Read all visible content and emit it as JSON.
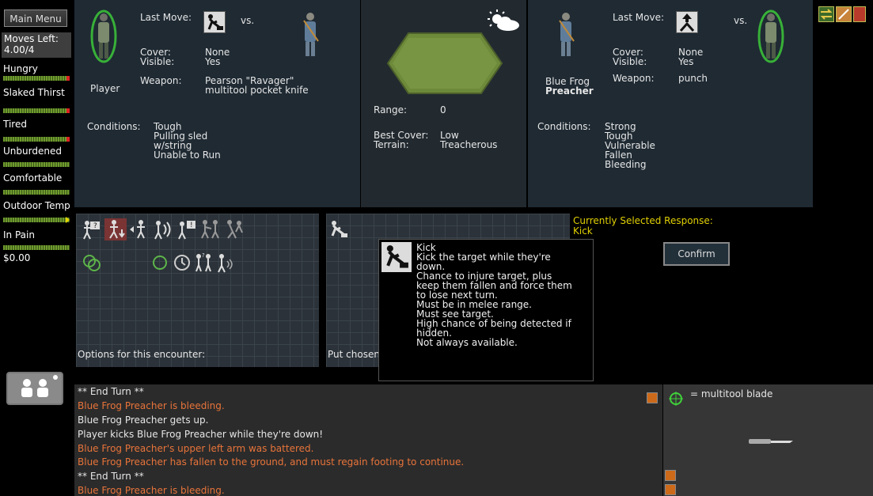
{
  "sidebar": {
    "main_menu": "Main Menu",
    "moves_left_label": "Moves Left:",
    "moves_left_value": "4.00/4",
    "statuses": [
      {
        "label": "Hungry",
        "indicator": "red"
      },
      {
        "label": "Slaked Thirst",
        "indicator": "red"
      },
      {
        "label": "Tired",
        "indicator": "red"
      },
      {
        "label": "Unburdened",
        "indicator": "none"
      },
      {
        "label": "Comfortable",
        "indicator": "none"
      },
      {
        "label": "Outdoor Temp",
        "indicator": "yellow"
      },
      {
        "label": "In Pain",
        "indicator": "none"
      }
    ],
    "money": "$0.00"
  },
  "player_panel": {
    "last_move_label": "Last Move:",
    "vs_label": "vs.",
    "name": "Player",
    "cover_label": "Cover:",
    "cover_value": "None",
    "visible_label": "Visible:",
    "visible_value": "Yes",
    "weapon_label": "Weapon:",
    "weapon_line1": "Pearson \"Ravager\"",
    "weapon_line2": "multitool pocket knife",
    "conditions_label": "Conditions:",
    "conditions": [
      "Tough",
      "Pulling sled",
      "w/string",
      "Unable to Run"
    ]
  },
  "center_panel": {
    "weather_icon": "partly-sunny-icon",
    "range_label": "Range:",
    "range_value": "0",
    "best_cover_label": "Best Cover:",
    "best_cover_value": "Low",
    "terrain_label": "Terrain:",
    "terrain_value": "Treacherous"
  },
  "enemy_panel": {
    "last_move_label": "Last Move:",
    "vs_label": "vs.",
    "name_line1": "Blue Frog",
    "name_line2": "Preacher",
    "cover_label": "Cover:",
    "cover_value": "None",
    "visible_label": "Visible:",
    "visible_value": "Yes",
    "weapon_label": "Weapon:",
    "weapon_value": "punch",
    "conditions_label": "Conditions:",
    "conditions": [
      "Strong",
      "Tough",
      "Vulnerable",
      "Fallen",
      "Bleeding"
    ]
  },
  "options_panel": {
    "caption": "Options for this encounter:"
  },
  "response_panel": {
    "caption": "Put chosen optio",
    "selected_label": "Currently Selected Response:",
    "selected_value": "Kick",
    "confirm": "Confirm"
  },
  "tooltip": {
    "title": "Kick",
    "lines": [
      "Kick the target while they're",
      "down.",
      "Chance to injure target, plus",
      "keep them fallen and force them",
      "to lose next turn.",
      "Must be in melee range.",
      "Must see target.",
      "High chance of being detected if",
      "hidden.",
      "Not always available."
    ]
  },
  "log": {
    "lines": [
      {
        "text": "** End Turn **",
        "color": "#e6e6e6"
      },
      {
        "text": "Blue Frog Preacher is bleeding.",
        "color": "#e8743a"
      },
      {
        "text": "Blue Frog Preacher gets up.",
        "color": "#e6e6e6"
      },
      {
        "text": "Player kicks Blue Frog Preacher while they're down!",
        "color": "#e6e6e6"
      },
      {
        "text": "Blue Frog Preacher's upper left arm was battered.",
        "color": "#e8743a"
      },
      {
        "text": "Blue Frog Preacher has fallen to the ground, and must regain footing to continue.",
        "color": "#e8743a"
      },
      {
        "text": "** End Turn **",
        "color": "#e6e6e6"
      },
      {
        "text": "Blue Frog Preacher is bleeding.",
        "color": "#e8743a"
      }
    ]
  },
  "weapon_panel": {
    "legend": "= multitool blade"
  },
  "colors": {
    "panel_bg": "#1f2a33",
    "selected_yellow": "#e0d000",
    "log_orange": "#e8743a"
  }
}
